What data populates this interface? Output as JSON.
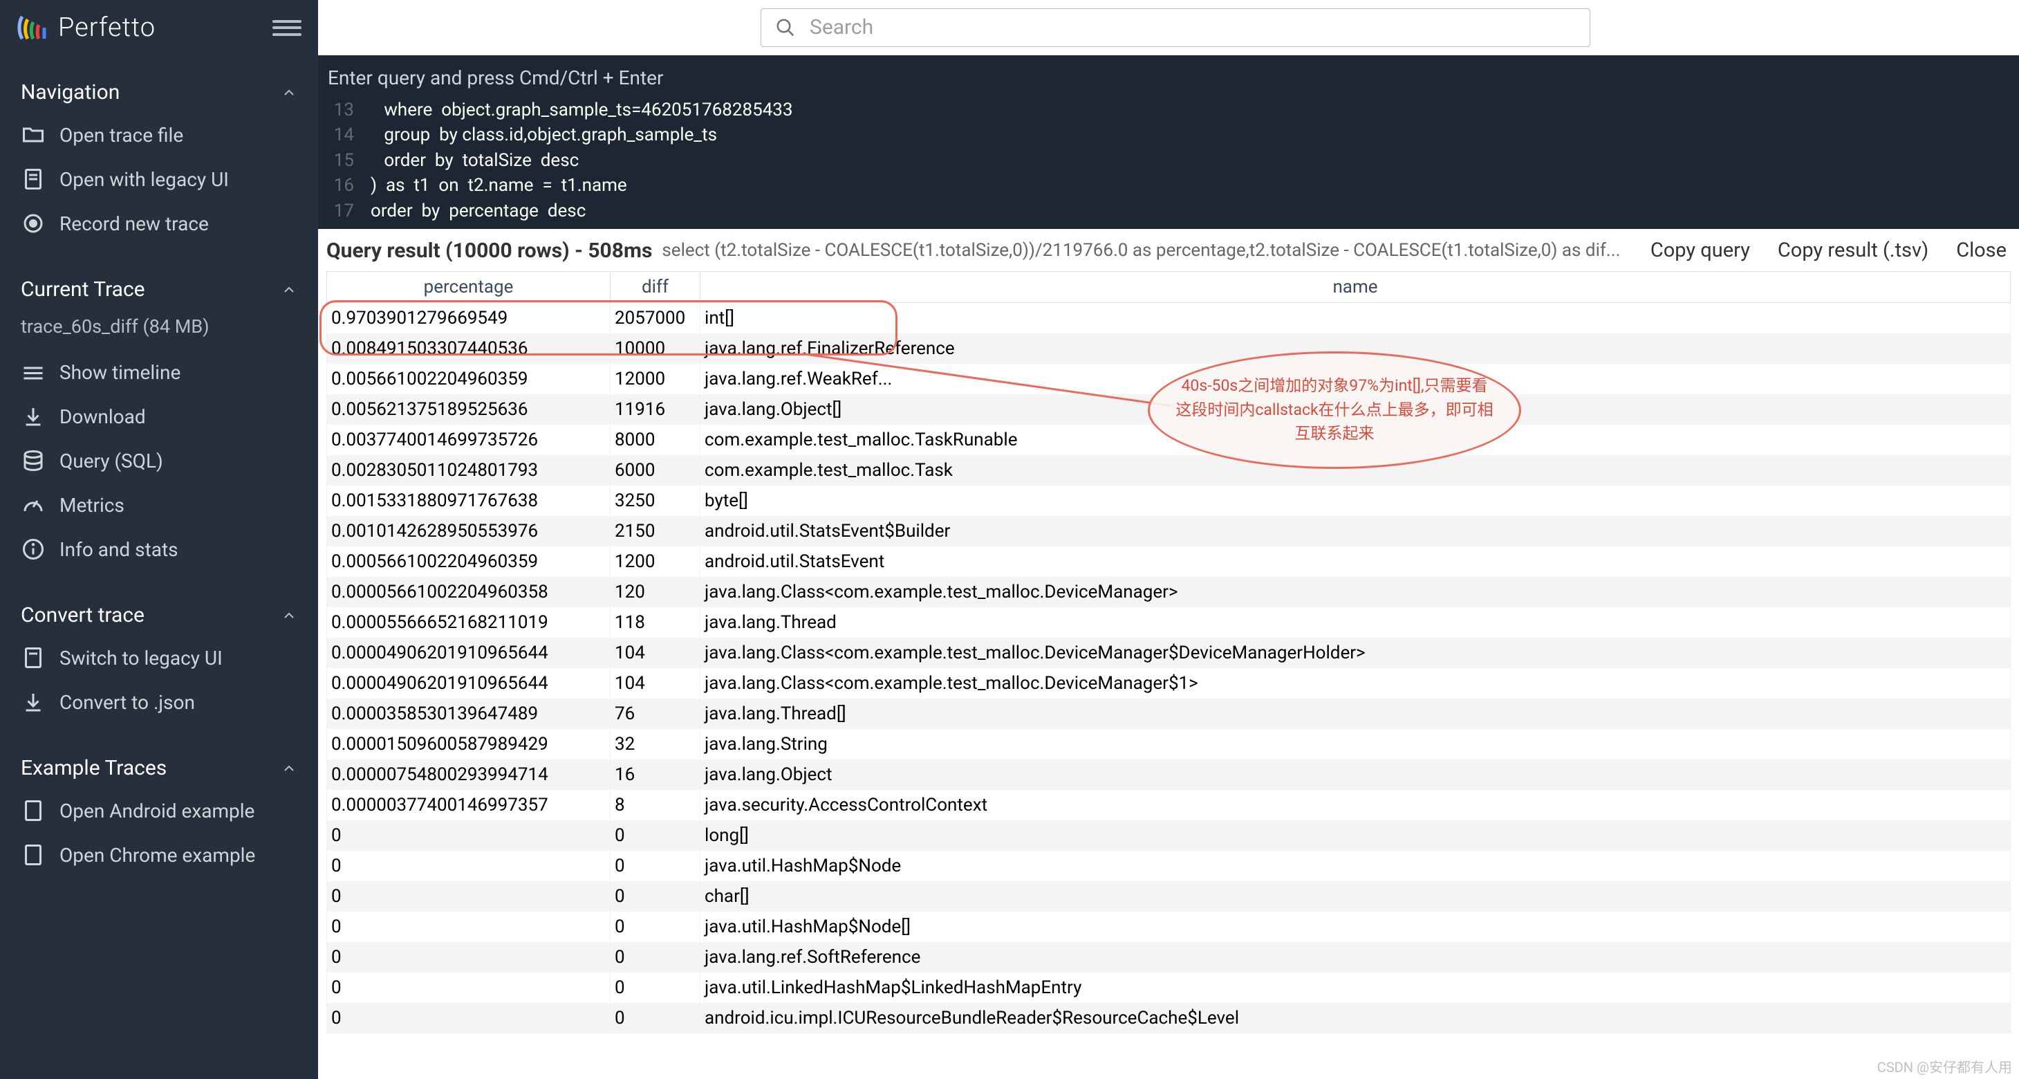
{
  "app": {
    "name": "Perfetto",
    "search_placeholder": "Search"
  },
  "sidebar": {
    "sections": {
      "navigation": {
        "title": "Navigation",
        "items": [
          "Open trace file",
          "Open with legacy UI",
          "Record new trace"
        ]
      },
      "current_trace": {
        "title": "Current Trace",
        "trace_name": "trace_60s_diff (84 MB)",
        "items": [
          "Show timeline",
          "Download",
          "Query (SQL)",
          "Metrics",
          "Info and stats"
        ]
      },
      "convert_trace": {
        "title": "Convert trace",
        "items": [
          "Switch to legacy UI",
          "Convert to .json"
        ]
      },
      "example_traces": {
        "title": "Example Traces",
        "items": [
          "Open Android example",
          "Open Chrome example"
        ]
      }
    }
  },
  "query": {
    "prompt": "Enter query and press Cmd/Ctrl + Enter",
    "lines": [
      {
        "no": "13",
        "text": "   where  object.graph_sample_ts=462051768285433"
      },
      {
        "no": "14",
        "text": "   group  by class.id,object.graph_sample_ts"
      },
      {
        "no": "15",
        "text": "   order  by  totalSize  desc"
      },
      {
        "no": "16",
        "text": ")  as  t1  on  t2.name  =  t1.name"
      },
      {
        "no": "17",
        "text": "order  by  percentage  desc"
      }
    ]
  },
  "result": {
    "title": "Query result (10000 rows) - 508ms",
    "sql": "select (t2.totalSize - COALESCE(t1.totalSize,0))/2119766.0 as percentage,t2.totalSize - COALESCE(t1.totalSize,0) as dif...",
    "actions": {
      "copy_query": "Copy query",
      "copy_result": "Copy result (.tsv)",
      "close": "Close"
    },
    "columns": [
      "percentage",
      "diff",
      "name"
    ],
    "rows": [
      {
        "percentage": "0.9703901279669549",
        "diff": "2057000",
        "name": "int[]"
      },
      {
        "percentage": "0.008491503307440536",
        "diff": "10000",
        "name": "java.lang.ref.FinalizerReference"
      },
      {
        "percentage": "0.005661002204960359",
        "diff": "12000",
        "name": "java.lang.ref.WeakRef..."
      },
      {
        "percentage": "0.005621375189525636",
        "diff": "11916",
        "name": "java.lang.Object[]"
      },
      {
        "percentage": "0.0037740014699735726",
        "diff": "8000",
        "name": "com.example.test_malloc.TaskRunable"
      },
      {
        "percentage": "0.0028305011024801793",
        "diff": "6000",
        "name": "com.example.test_malloc.Task"
      },
      {
        "percentage": "0.0015331880971767638",
        "diff": "3250",
        "name": "byte[]"
      },
      {
        "percentage": "0.0010142628950553976",
        "diff": "2150",
        "name": "android.util.StatsEvent$Builder"
      },
      {
        "percentage": "0.0005661002204960359",
        "diff": "1200",
        "name": "android.util.StatsEvent"
      },
      {
        "percentage": "0.00005661002204960358",
        "diff": "120",
        "name": "java.lang.Class<com.example.test_malloc.DeviceManager>"
      },
      {
        "percentage": "0.00005566652168211019",
        "diff": "118",
        "name": "java.lang.Thread"
      },
      {
        "percentage": "0.00004906201910965644",
        "diff": "104",
        "name": "java.lang.Class<com.example.test_malloc.DeviceManager$DeviceManagerHolder>"
      },
      {
        "percentage": "0.00004906201910965644",
        "diff": "104",
        "name": "java.lang.Class<com.example.test_malloc.DeviceManager$1>"
      },
      {
        "percentage": "0.0000358530139647489",
        "diff": "76",
        "name": "java.lang.Thread[]"
      },
      {
        "percentage": "0.00001509600587989429",
        "diff": "32",
        "name": "java.lang.String"
      },
      {
        "percentage": "0.00000754800293994714",
        "diff": "16",
        "name": "java.lang.Object"
      },
      {
        "percentage": "0.00000377400146997357",
        "diff": "8",
        "name": "java.security.AccessControlContext"
      },
      {
        "percentage": "0",
        "diff": "0",
        "name": "long[]"
      },
      {
        "percentage": "0",
        "diff": "0",
        "name": "java.util.HashMap$Node"
      },
      {
        "percentage": "0",
        "diff": "0",
        "name": "char[]"
      },
      {
        "percentage": "0",
        "diff": "0",
        "name": "java.util.HashMap$Node[]"
      },
      {
        "percentage": "0",
        "diff": "0",
        "name": "java.lang.ref.SoftReference"
      },
      {
        "percentage": "0",
        "diff": "0",
        "name": "java.util.LinkedHashMap$LinkedHashMapEntry"
      },
      {
        "percentage": "0",
        "diff": "0",
        "name": "android.icu.impl.ICUResourceBundleReader$ResourceCache$Level"
      }
    ]
  },
  "annotation": {
    "text": "40s-50s之间增加的对象97%为int[],只需要看这段时间内callstack在什么点上最多，即可相互联系起来"
  },
  "watermark": "CSDN @安仔都有人用"
}
